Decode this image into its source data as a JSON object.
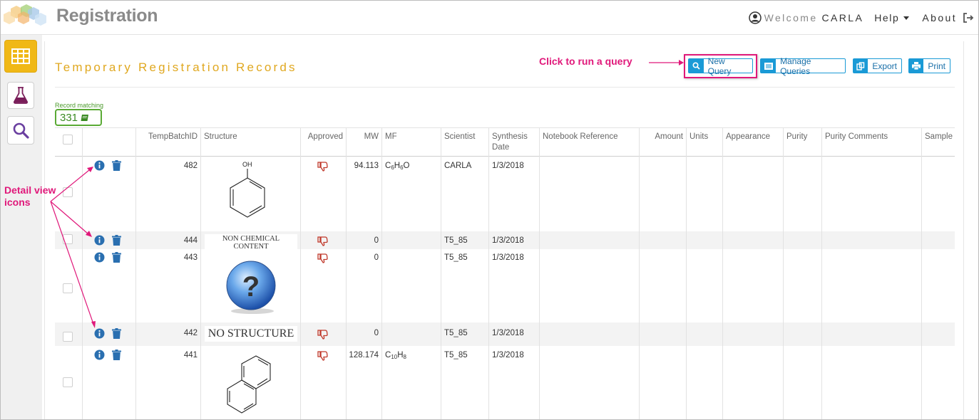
{
  "app": {
    "brand": "Registration"
  },
  "nav": {
    "welcome": "Welcome",
    "user": "CARLA",
    "help": "Help",
    "about": "About"
  },
  "icons": {
    "logo": "hexagon-logo-icon",
    "user": "user-circle-icon",
    "signout": "sign-out-icon",
    "grid": "table-grid-icon",
    "flask": "flask-icon",
    "search": "magnifier-icon",
    "info": "info-circle-icon",
    "trash": "trash-icon",
    "thumb": "thumbs-down-icon"
  },
  "colors": {
    "accent": "#f0b816",
    "title": "#e0a820",
    "button": "#1a9ad6",
    "annotation": "#e0187a",
    "badge": "#5aaa35",
    "thumb": "#c0392b",
    "icon": "#2a6fb0"
  },
  "page": {
    "title": "Temporary Registration Records",
    "record_matching_label": "Record matching",
    "record_count": "331"
  },
  "toolbar": {
    "new_query": "New Query",
    "manage_queries": "Manage Queries",
    "export": "Export",
    "print": "Print"
  },
  "annotations": {
    "run_query": "Click to run a query",
    "detail_view_1": "Detail view",
    "detail_view_2": "icons"
  },
  "table": {
    "columns": {
      "temp_batch_id": "TempBatchID",
      "structure": "Structure",
      "approved": "Approved",
      "mw": "MW",
      "mf": "MF",
      "scientist": "Scientist",
      "synthesis_1": "Synthesis",
      "synthesis_2": "Date",
      "notebook": "Notebook Reference",
      "amount": "Amount",
      "units": "Units",
      "appearance": "Appearance",
      "purity": "Purity",
      "purity_comments": "Purity Comments",
      "sample": "Sample"
    },
    "rows": [
      {
        "id": "482",
        "structure": "OH",
        "mw": "94.113",
        "mf_parts": [
          "C",
          "6",
          "H",
          "6",
          "O"
        ],
        "scientist": "CARLA",
        "date": "1/3/2018"
      },
      {
        "id": "444",
        "structure": "NON CHEMICAL CONTENT",
        "mw": "0",
        "scientist": "T5_85",
        "date": "1/3/2018"
      },
      {
        "id": "443",
        "structure": "?",
        "mw": "0",
        "scientist": "T5_85",
        "date": "1/3/2018"
      },
      {
        "id": "442",
        "structure": "NO STRUCTURE",
        "mw": "0",
        "scientist": "T5_85",
        "date": "1/3/2018"
      },
      {
        "id": "441",
        "structure": "",
        "mw": "128.174",
        "mf_parts": [
          "C",
          "10",
          "H",
          "8"
        ],
        "scientist": "T5_85",
        "date": "1/3/2018"
      }
    ]
  }
}
